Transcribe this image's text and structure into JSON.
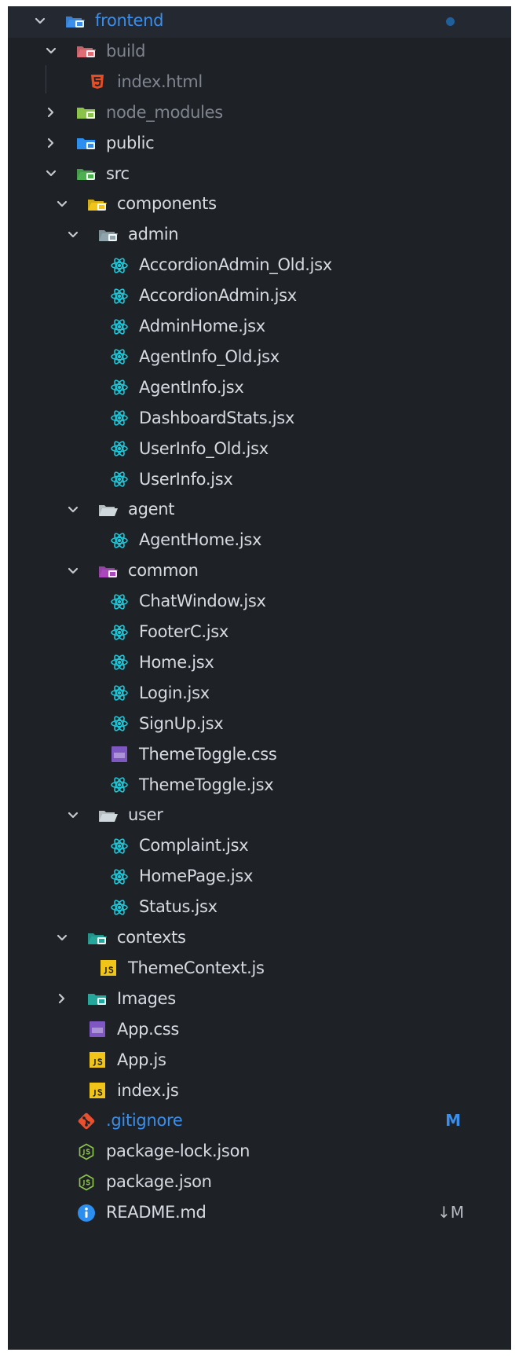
{
  "colors": {
    "panel_bg": "#1e2227",
    "text": "#d7dae0",
    "text_dim": "#7f848e",
    "text_modified": "#3b8eea",
    "badge_modified": "#3b8eea",
    "badge_updated": "#b9bcc2",
    "react_icon": "#1fc7d8",
    "js_icon_bg": "#f0c419",
    "css_icon_bg": "#7e57c2",
    "html_icon": "#e44d26",
    "git_icon": "#e8502f",
    "json_icon": "#8bc34a",
    "info_icon": "#2c8ff0"
  },
  "tree": [
    {
      "label": "frontend",
      "depth": 0,
      "type": "folder",
      "expanded": true,
      "icon": "folder-frontend-icon",
      "icon_color": "#3b8eea",
      "label_style": "blue",
      "status_dot": true
    },
    {
      "label": "build",
      "depth": 1,
      "type": "folder",
      "expanded": true,
      "icon": "folder-build-icon",
      "icon_color": "#e06c75",
      "label_style": "dim"
    },
    {
      "label": "index.html",
      "depth": 2,
      "type": "file",
      "icon": "html-file-icon",
      "label_style": "dim"
    },
    {
      "label": "node_modules",
      "depth": 1,
      "type": "folder",
      "expanded": false,
      "icon": "folder-node-modules-icon",
      "icon_color": "#8bc34a",
      "label_style": "dim"
    },
    {
      "label": "public",
      "depth": 1,
      "type": "folder",
      "expanded": false,
      "icon": "folder-public-icon",
      "icon_color": "#2c8ff0"
    },
    {
      "label": "src",
      "depth": 1,
      "type": "folder",
      "expanded": true,
      "icon": "folder-src-icon",
      "icon_color": "#4caf50"
    },
    {
      "label": "components",
      "depth": 2,
      "type": "folder",
      "expanded": true,
      "icon": "folder-components-icon",
      "icon_color": "#f0c419"
    },
    {
      "label": "admin",
      "depth": 3,
      "type": "folder",
      "expanded": true,
      "icon": "folder-admin-icon",
      "icon_color": "#90a4ae"
    },
    {
      "label": "AccordionAdmin_Old.jsx",
      "depth": 4,
      "type": "file",
      "icon": "react-icon"
    },
    {
      "label": "AccordionAdmin.jsx",
      "depth": 4,
      "type": "file",
      "icon": "react-icon"
    },
    {
      "label": "AdminHome.jsx",
      "depth": 4,
      "type": "file",
      "icon": "react-icon"
    },
    {
      "label": "AgentInfo_Old.jsx",
      "depth": 4,
      "type": "file",
      "icon": "react-icon"
    },
    {
      "label": "AgentInfo.jsx",
      "depth": 4,
      "type": "file",
      "icon": "react-icon"
    },
    {
      "label": "DashboardStats.jsx",
      "depth": 4,
      "type": "file",
      "icon": "react-icon"
    },
    {
      "label": "UserInfo_Old.jsx",
      "depth": 4,
      "type": "file",
      "icon": "react-icon"
    },
    {
      "label": "UserInfo.jsx",
      "depth": 4,
      "type": "file",
      "icon": "react-icon"
    },
    {
      "label": "agent",
      "depth": 3,
      "type": "folder",
      "expanded": true,
      "icon": "folder-agent-icon",
      "icon_color": "#cfd8dc"
    },
    {
      "label": "AgentHome.jsx",
      "depth": 4,
      "type": "file",
      "icon": "react-icon"
    },
    {
      "label": "common",
      "depth": 3,
      "type": "folder",
      "expanded": true,
      "icon": "folder-common-icon",
      "icon_color": "#ab47bc"
    },
    {
      "label": "ChatWindow.jsx",
      "depth": 4,
      "type": "file",
      "icon": "react-icon"
    },
    {
      "label": "FooterC.jsx",
      "depth": 4,
      "type": "file",
      "icon": "react-icon"
    },
    {
      "label": "Home.jsx",
      "depth": 4,
      "type": "file",
      "icon": "react-icon"
    },
    {
      "label": "Login.jsx",
      "depth": 4,
      "type": "file",
      "icon": "react-icon"
    },
    {
      "label": "SignUp.jsx",
      "depth": 4,
      "type": "file",
      "icon": "react-icon"
    },
    {
      "label": "ThemeToggle.css",
      "depth": 4,
      "type": "file",
      "icon": "css-file-icon"
    },
    {
      "label": "ThemeToggle.jsx",
      "depth": 4,
      "type": "file",
      "icon": "react-icon"
    },
    {
      "label": "user",
      "depth": 3,
      "type": "folder",
      "expanded": true,
      "icon": "folder-user-icon",
      "icon_color": "#cfd8dc"
    },
    {
      "label": "Complaint.jsx",
      "depth": 4,
      "type": "file",
      "icon": "react-icon"
    },
    {
      "label": "HomePage.jsx",
      "depth": 4,
      "type": "file",
      "icon": "react-icon"
    },
    {
      "label": "Status.jsx",
      "depth": 4,
      "type": "file",
      "icon": "react-icon"
    },
    {
      "label": "contexts",
      "depth": 2,
      "type": "folder",
      "expanded": true,
      "icon": "folder-contexts-icon",
      "icon_color": "#26a69a"
    },
    {
      "label": "ThemeContext.js",
      "depth": 3,
      "type": "file",
      "icon": "js-file-icon"
    },
    {
      "label": "Images",
      "depth": 2,
      "type": "folder",
      "expanded": false,
      "icon": "folder-images-icon",
      "icon_color": "#26a69a"
    },
    {
      "label": "App.css",
      "depth": 2,
      "type": "file",
      "icon": "css-file-icon"
    },
    {
      "label": "App.js",
      "depth": 2,
      "type": "file",
      "icon": "js-file-icon"
    },
    {
      "label": "index.js",
      "depth": 2,
      "type": "file",
      "icon": "js-file-icon"
    },
    {
      "label": ".gitignore",
      "depth": 1,
      "type": "file",
      "icon": "git-icon",
      "label_style": "blue",
      "badge": "M",
      "badge_style": "modified"
    },
    {
      "label": "package-lock.json",
      "depth": 1,
      "type": "file",
      "icon": "json-file-icon"
    },
    {
      "label": "package.json",
      "depth": 1,
      "type": "file",
      "icon": "json-file-icon"
    },
    {
      "label": "README.md",
      "depth": 1,
      "type": "file",
      "icon": "info-icon",
      "badge": "↓M",
      "badge_style": "updated"
    }
  ]
}
